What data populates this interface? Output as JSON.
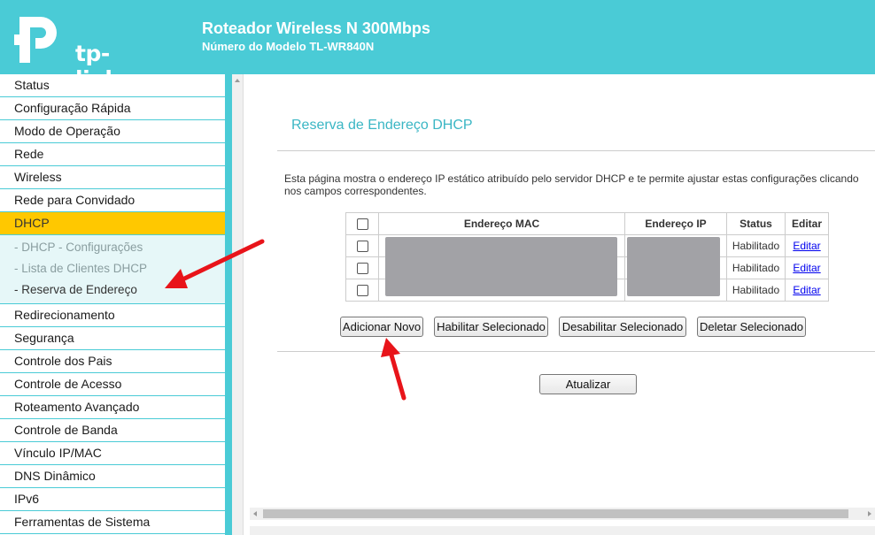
{
  "header": {
    "logo_text": "tp-link",
    "title": "Roteador Wireless N 300Mbps",
    "model": "Número do Modelo TL-WR840N",
    "bg_color": "#4acbd6"
  },
  "sidebar": {
    "items_before": [
      "Status",
      "Configuração Rápida",
      "Modo de Operação",
      "Rede",
      "Wireless",
      "Rede para Convidado"
    ],
    "active_item": "DHCP",
    "sub_items": [
      "- DHCP - Configurações",
      "- Lista de Clientes DHCP",
      "- Reserva de Endereço"
    ],
    "current_sub_item": "- Reserva de Endereço",
    "items_after": [
      "Redirecionamento",
      "Segurança",
      "Controle dos Pais",
      "Controle de Acesso",
      "Roteamento Avançado",
      "Controle de Banda",
      "Vínculo IP/MAC",
      "DNS Dinâmico",
      "IPv6",
      "Ferramentas de Sistema"
    ],
    "active_color": "#ffc800"
  },
  "main": {
    "title": "Reserva de Endereço DHCP",
    "description": "Esta página mostra o endereço IP estático atribuído pelo servidor DHCP e te permite ajustar estas configurações clicando nos campos correspondentes.",
    "table": {
      "headers": {
        "mac": "Endereço MAC",
        "ip": "Endereço IP",
        "status": "Status",
        "edit": "Editar"
      },
      "rows": [
        {
          "status": "Habilitado",
          "edit": "Editar"
        },
        {
          "status": "Habilitado",
          "edit": "Editar"
        },
        {
          "status": "Habilitado",
          "edit": "Editar"
        }
      ]
    },
    "buttons": {
      "add_new": "Adicionar Novo",
      "enable_selected": "Habilitar Selecionado",
      "disable_selected": "Desabilitar Selecionado",
      "delete_selected": "Deletar Selecionado",
      "refresh": "Atualizar"
    }
  }
}
